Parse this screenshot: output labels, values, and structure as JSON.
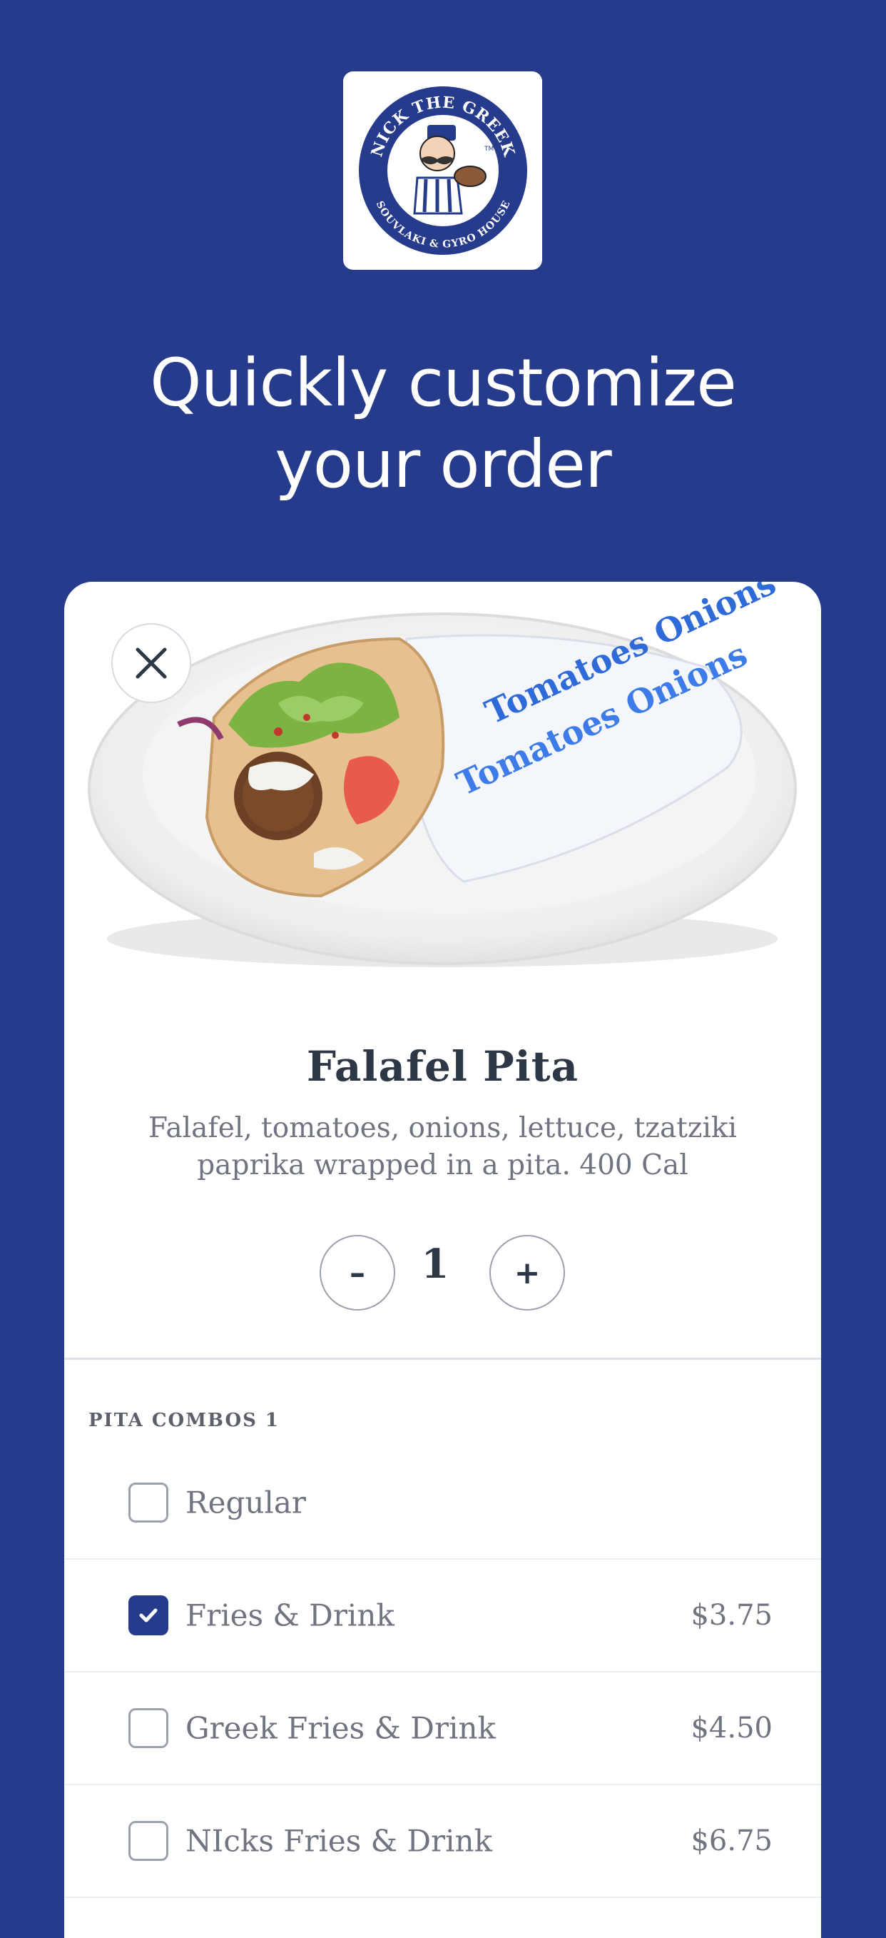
{
  "colors": {
    "brand_blue": "#263b8c",
    "text_dark": "#2e3746",
    "text_muted": "#6f7480"
  },
  "logo": {
    "alt": "Nick The Greek Souvlaki & Gyro House logo",
    "top_text": "NICK THE GREEK",
    "bottom_text": "SOUVLAKI & GYRO HOUSE",
    "tm": "TM"
  },
  "headline": {
    "line1": "Quickly customize",
    "line2": "your order"
  },
  "product": {
    "image": "falafel-pita-photo",
    "wrap_text": "Tomatoes Onions",
    "title": "Falafel Pita",
    "description": "Falafel, tomatoes, onions, lettuce, tzatziki paprika wrapped in a pita. 400 Cal"
  },
  "quantity": {
    "minus": "–",
    "value": "1",
    "plus": "+"
  },
  "section": {
    "label": "PITA COMBOS 1"
  },
  "options": [
    {
      "label": "Regular",
      "price": "",
      "checked": false
    },
    {
      "label": "Fries & Drink",
      "price": "$3.75",
      "checked": true
    },
    {
      "label": "Greek Fries & Drink",
      "price": "$4.50",
      "checked": false
    },
    {
      "label": "NIcks Fries & Drink",
      "price": "$6.75",
      "checked": false
    }
  ]
}
